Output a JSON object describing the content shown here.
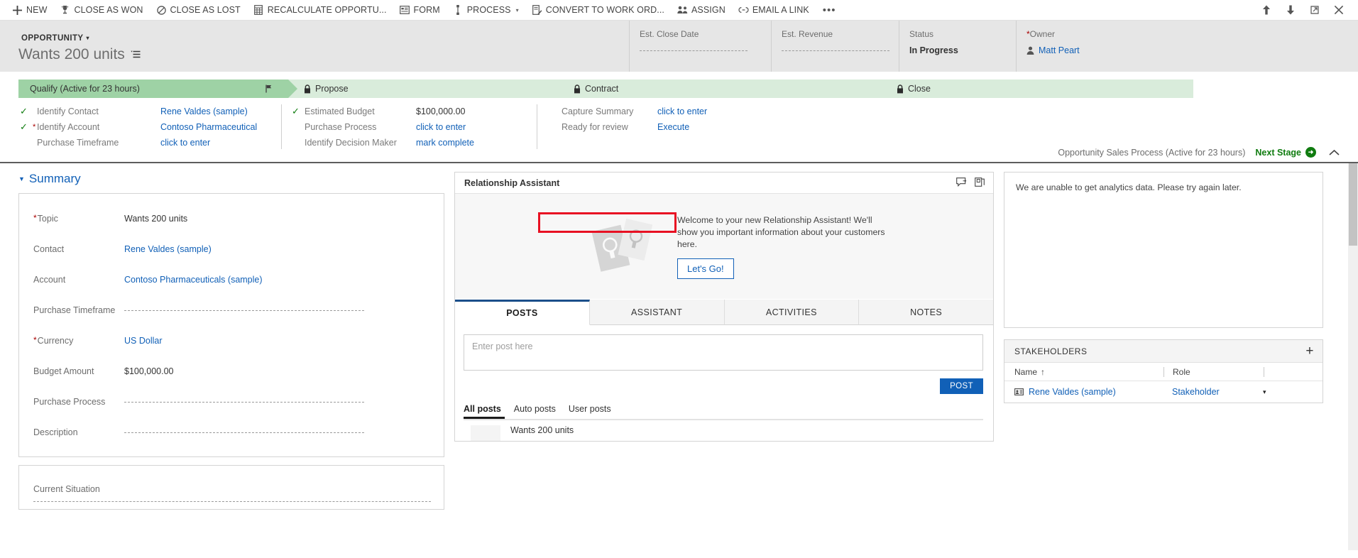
{
  "commandbar": {
    "buttons": [
      {
        "label": "NEW",
        "icon": "plus-icon"
      },
      {
        "label": "CLOSE AS WON",
        "icon": "trophy-icon"
      },
      {
        "label": "CLOSE AS LOST",
        "icon": "no-entry-icon"
      },
      {
        "label": "RECALCULATE OPPORTU...",
        "icon": "calculator-icon"
      },
      {
        "label": "FORM",
        "icon": "form-icon"
      },
      {
        "label": "PROCESS",
        "icon": "process-icon",
        "caret": "▾"
      },
      {
        "label": "CONVERT TO WORK ORD...",
        "icon": "convert-work-order-icon"
      },
      {
        "label": "ASSIGN",
        "icon": "assign-people-icon"
      },
      {
        "label": "EMAIL A LINK",
        "icon": "link-icon"
      }
    ],
    "overflow_label": "•••",
    "window_icons": [
      "up-arrow-icon",
      "down-arrow-icon",
      "popout-icon",
      "close-icon"
    ]
  },
  "record_header": {
    "entity_chip": "OPPORTUNITY",
    "entity_caret": "▾",
    "title": "Wants 200 units",
    "title_menu_icon": "title-options-icon",
    "fields": [
      {
        "label": "Est. Close Date",
        "value": "",
        "required": false,
        "type": "dash"
      },
      {
        "label": "Est. Revenue",
        "value": "",
        "required": false,
        "type": "dash"
      },
      {
        "label": "Status",
        "value": "In Progress",
        "required": false,
        "type": "text"
      },
      {
        "label": "Owner",
        "value": "Matt Peart",
        "required": true,
        "type": "link"
      }
    ]
  },
  "bpf": {
    "stages": [
      {
        "label": "Qualify (Active for 23 hours)",
        "state": "active",
        "locked": false
      },
      {
        "label": "Propose",
        "state": "inactive",
        "locked": true
      },
      {
        "label": "Contract",
        "state": "inactive",
        "locked": true
      },
      {
        "label": "Close",
        "state": "inactive",
        "locked": true
      }
    ],
    "columns": [
      {
        "steps": [
          {
            "complete": true,
            "required": false,
            "name": "Identify Contact",
            "value": "Rene Valdes (sample)",
            "link": true
          },
          {
            "complete": true,
            "required": true,
            "name": "Identify Account",
            "value": "Contoso Pharmaceutical",
            "link": true
          },
          {
            "complete": false,
            "required": false,
            "name": "Purchase Timeframe",
            "value": "click to enter",
            "link": true
          }
        ]
      },
      {
        "steps": [
          {
            "complete": true,
            "required": false,
            "name": "Estimated Budget",
            "value": "$100,000.00",
            "link": false
          },
          {
            "complete": false,
            "required": false,
            "name": "Purchase Process",
            "value": "click to enter",
            "link": true
          },
          {
            "complete": false,
            "required": false,
            "name": "Identify Decision Maker",
            "value": "mark complete",
            "link": true
          }
        ]
      },
      {
        "steps": [
          {
            "complete": false,
            "required": false,
            "name": "Capture Summary",
            "value": "click to enter",
            "link": true
          },
          {
            "complete": false,
            "required": false,
            "name": "Ready for review",
            "value": "Execute",
            "link": true
          }
        ]
      }
    ],
    "process_name": "Opportunity Sales Process (Active for 23 hours)",
    "next_stage_label": "Next Stage",
    "next_stage_icon": "arrow-right-circle-icon",
    "collapse_icon": "chevron-up-icon",
    "highlight_color": "#e81123"
  },
  "summary": {
    "section_title": "Summary",
    "fields": [
      {
        "label": "Topic",
        "required": true,
        "value": "Wants 200 units",
        "kind": "text"
      },
      {
        "label": "Contact",
        "required": false,
        "value": "Rene Valdes (sample)",
        "kind": "link"
      },
      {
        "label": "Account",
        "required": false,
        "value": "Contoso Pharmaceuticals (sample)",
        "kind": "link"
      },
      {
        "label": "Purchase Timeframe",
        "required": false,
        "value": "",
        "kind": "empty"
      },
      {
        "label": "Currency",
        "required": true,
        "value": "US Dollar",
        "kind": "link"
      },
      {
        "label": "Budget Amount",
        "required": false,
        "value": "$100,000.00",
        "kind": "text"
      },
      {
        "label": "Purchase Process",
        "required": false,
        "value": "",
        "kind": "empty"
      },
      {
        "label": "Description",
        "required": false,
        "value": "",
        "kind": "empty"
      }
    ],
    "current_situation_label": "Current Situation"
  },
  "relationship_assistant": {
    "title": "Relationship Assistant",
    "header_icons": [
      "comment-icon",
      "copy-icon"
    ],
    "welcome_text": "Welcome to your new Relationship Assistant! We'll show you important information about your customers here.",
    "cta_label": "Let's Go!",
    "art_icon": "lightbulb-cards-icon"
  },
  "social_pane": {
    "tabs": [
      {
        "label": "POSTS",
        "active": true
      },
      {
        "label": "ASSISTANT",
        "active": false
      },
      {
        "label": "ACTIVITIES",
        "active": false
      },
      {
        "label": "NOTES",
        "active": false
      }
    ],
    "post_placeholder": "Enter post here",
    "post_button": "POST",
    "filters": [
      {
        "label": "All posts",
        "active": true
      },
      {
        "label": "Auto posts",
        "active": false
      },
      {
        "label": "User posts",
        "active": false
      }
    ],
    "first_post_title": "Wants 200 units"
  },
  "analytics": {
    "message": "We are unable to get analytics data. Please try again later."
  },
  "stakeholders": {
    "title": "STAKEHOLDERS",
    "add_icon": "plus-icon",
    "columns": [
      {
        "label": "Name",
        "sort": "↑"
      },
      {
        "label": "Role",
        "sort": ""
      }
    ],
    "rows": [
      {
        "name": "Rene Valdes (sample)",
        "role": "Stakeholder",
        "icon": "contact-card-icon",
        "menu": "▾"
      }
    ]
  },
  "colors": {
    "stage_active": "#9ed2a5",
    "stage_inactive": "#d9ecdb",
    "link": "#1160b7",
    "accent_green": "#107c10",
    "required_red": "#a80000",
    "header_bg": "#e6e6e6"
  }
}
